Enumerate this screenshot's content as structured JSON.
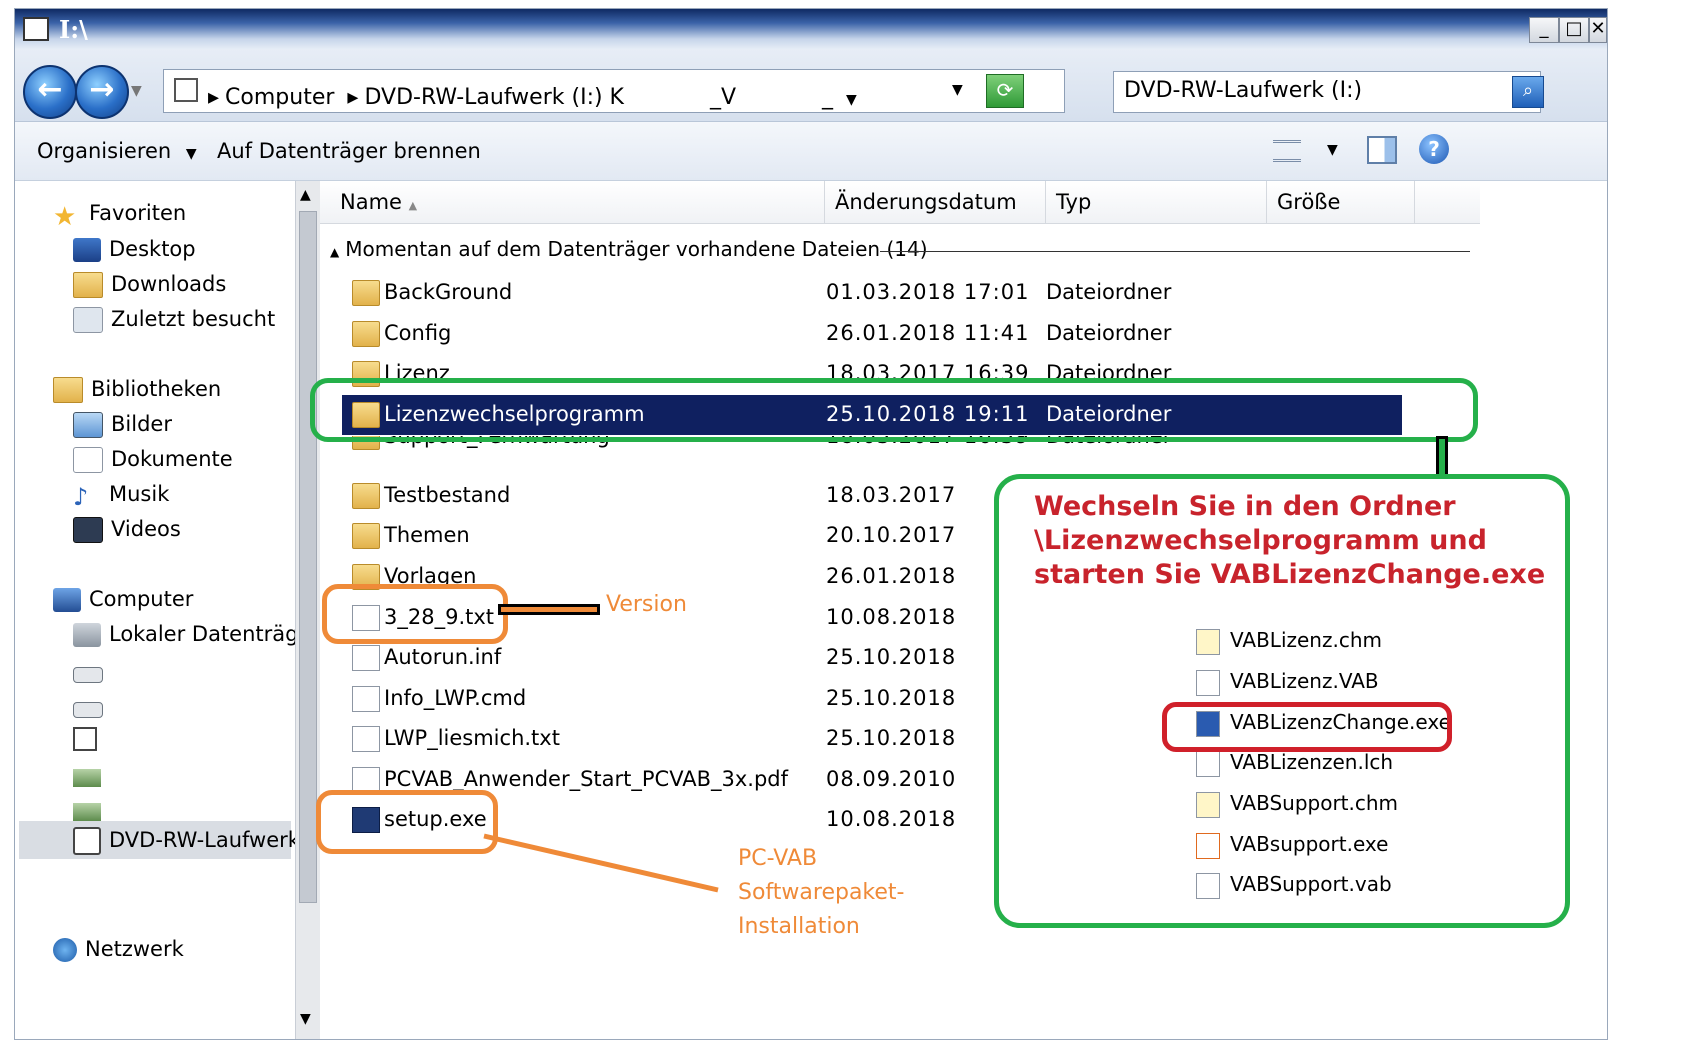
{
  "window": {
    "title": "I:\\"
  },
  "address": {
    "crumbs": [
      "Computer",
      "DVD-RW-Laufwerk (I:) K",
      "_V",
      "_"
    ],
    "search_value": "DVD-RW-Laufwerk (I:)"
  },
  "toolbar": {
    "organize": "Organisieren",
    "burn": "Auf Datenträger brennen"
  },
  "nav": {
    "favorites": "Favoriten",
    "desktop": "Desktop",
    "downloads": "Downloads",
    "recent": "Zuletzt besucht",
    "libraries": "Bibliotheken",
    "pictures": "Bilder",
    "documents": "Dokumente",
    "music": "Musik",
    "videos": "Videos",
    "computer": "Computer",
    "local_disk": "Lokaler Datenträge",
    "dvd": "DVD-RW-Laufwerk",
    "network": "Netzwerk"
  },
  "columns": {
    "name": "Name",
    "date": "Änderungsdatum",
    "type": "Typ",
    "size": "Größe"
  },
  "group_label": "Momentan auf dem Datenträger vorhandene Dateien (14)",
  "files": [
    {
      "name": "BackGround",
      "date": "01.03.2018 17:01",
      "type": "Dateiordner",
      "kind": "folder"
    },
    {
      "name": "Config",
      "date": "26.01.2018 11:41",
      "type": "Dateiordner",
      "kind": "folder"
    },
    {
      "name": "Lizenz",
      "date": "18.03.2017 16:39",
      "type": "Dateiordner",
      "kind": "folder"
    },
    {
      "name": "Lizenzwechselprogramm",
      "date": "25.10.2018 19:11",
      "type": "Dateiordner",
      "kind": "folder",
      "selected": true
    },
    {
      "name": "Support_Fernwartung",
      "date": "18.03.2017 16:39",
      "type": "Dateiordner",
      "kind": "folder"
    },
    {
      "name": "Testbestand",
      "date": "18.03.2017",
      "type": "",
      "kind": "folder"
    },
    {
      "name": "Themen",
      "date": "20.10.2017",
      "type": "",
      "kind": "folder"
    },
    {
      "name": "Vorlagen",
      "date": "26.01.2018",
      "type": "",
      "kind": "folder"
    },
    {
      "name": "3_28_9.txt",
      "date": "10.08.2018",
      "type": "",
      "kind": "file"
    },
    {
      "name": "Autorun.inf",
      "date": "25.10.2018",
      "type": "",
      "kind": "file"
    },
    {
      "name": "Info_LWP.cmd",
      "date": "25.10.2018",
      "type": "",
      "kind": "file"
    },
    {
      "name": "LWP_liesmich.txt",
      "date": "25.10.2018",
      "type": "",
      "kind": "file"
    },
    {
      "name": "PCVAB_Anwender_Start_PCVAB_3x.pdf",
      "date": "08.09.2010",
      "type": "",
      "kind": "file"
    },
    {
      "name": "setup.exe",
      "date": "10.08.2018",
      "type": "",
      "kind": "exe"
    }
  ],
  "annotations": {
    "version_label": "Version",
    "install_label_1": "PC-VAB",
    "install_label_2": "Softwarepaket-",
    "install_label_3": "Installation",
    "instruction_1": "Wechseln Sie in den Ordner",
    "instruction_2": "\\Lizenzwechselprogramm und",
    "instruction_3": "starten Sie VABLizenzChange.exe",
    "subfiles": [
      "VABLizenz.chm",
      "VABLizenz.VAB",
      "VABLizenzChange.exe",
      "VABLizenzen.lch",
      "VABSupport.chm",
      "VABsupport.exe",
      "VABSupport.vab"
    ]
  },
  "colors": {
    "selection": "#0f2060",
    "green_annotation": "#25b04a",
    "orange_annotation": "#ef8a38",
    "red_annotation": "#d0202a",
    "instruction_text": "#c8232c"
  }
}
